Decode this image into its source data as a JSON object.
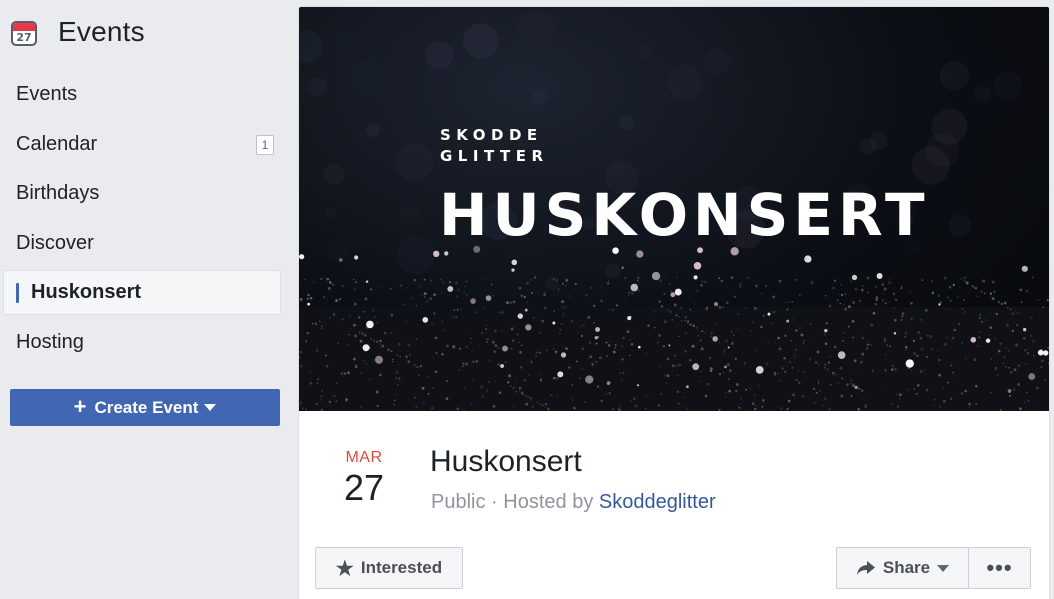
{
  "sidebar": {
    "title": "Events",
    "calendar_icon_day": "27",
    "items": [
      {
        "label": "Events",
        "badge": null
      },
      {
        "label": "Calendar",
        "badge": "1"
      },
      {
        "label": "Birthdays",
        "badge": null
      },
      {
        "label": "Discover",
        "badge": null
      },
      {
        "label": "Huskonsert",
        "badge": null
      },
      {
        "label": "Hosting",
        "badge": null
      }
    ],
    "active_item": "Huskonsert",
    "create_button": {
      "label": "Create Event",
      "icon": "plus-icon"
    }
  },
  "cover": {
    "brand_line1": "SKODDE",
    "brand_line2": "GLITTER",
    "headline": "HUSKONSERT"
  },
  "event": {
    "month": "MAR",
    "day": "27",
    "title": "Huskonsert",
    "privacy": "Public",
    "hosted_by_prefix": "Hosted by",
    "host": "Skoddeglitter"
  },
  "actions": {
    "interested_label": "Interested",
    "share_label": "Share",
    "more_label": "•••"
  },
  "colors": {
    "accent": "#4267b2",
    "link": "#365899",
    "month": "#e04a3f",
    "background": "#e9ebee"
  }
}
